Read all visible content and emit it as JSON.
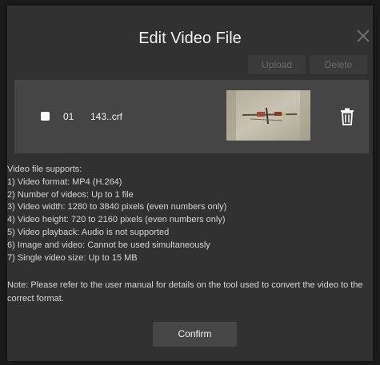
{
  "dialog": {
    "title": "Edit Video File",
    "close_icon": "close-icon"
  },
  "toolbar": {
    "upload_label": "Upload",
    "delete_label": "Delete"
  },
  "file": {
    "index": "01",
    "name": "143..crf",
    "thumbnail_icon": "video-thumbnail",
    "delete_icon": "trash-icon"
  },
  "info": {
    "lines": [
      "Video file supports:",
      "1) Video format: MP4 (H.264)",
      "2) Number of videos: Up to 1 file",
      "3) Video width: 1280 to 3840 pixels (even numbers only)",
      "4) Video height: 720 to 2160 pixels (even numbers only)",
      "5) Video playback: Audio is not supported",
      "6) Image and video: Cannot be used simultaneously",
      "7) Single video size: Up to 15 MB"
    ],
    "note": "Note: Please refer to the user manual for details on the tool used to convert the video to the correct format."
  },
  "footer": {
    "confirm_label": "Confirm"
  },
  "colors": {
    "backdrop": "#1b1b1b",
    "dialog": "#313131",
    "file_row": "#454545",
    "button": "#474747",
    "disabled_text": "#6a6a6a",
    "text": "#d6d6d6"
  }
}
